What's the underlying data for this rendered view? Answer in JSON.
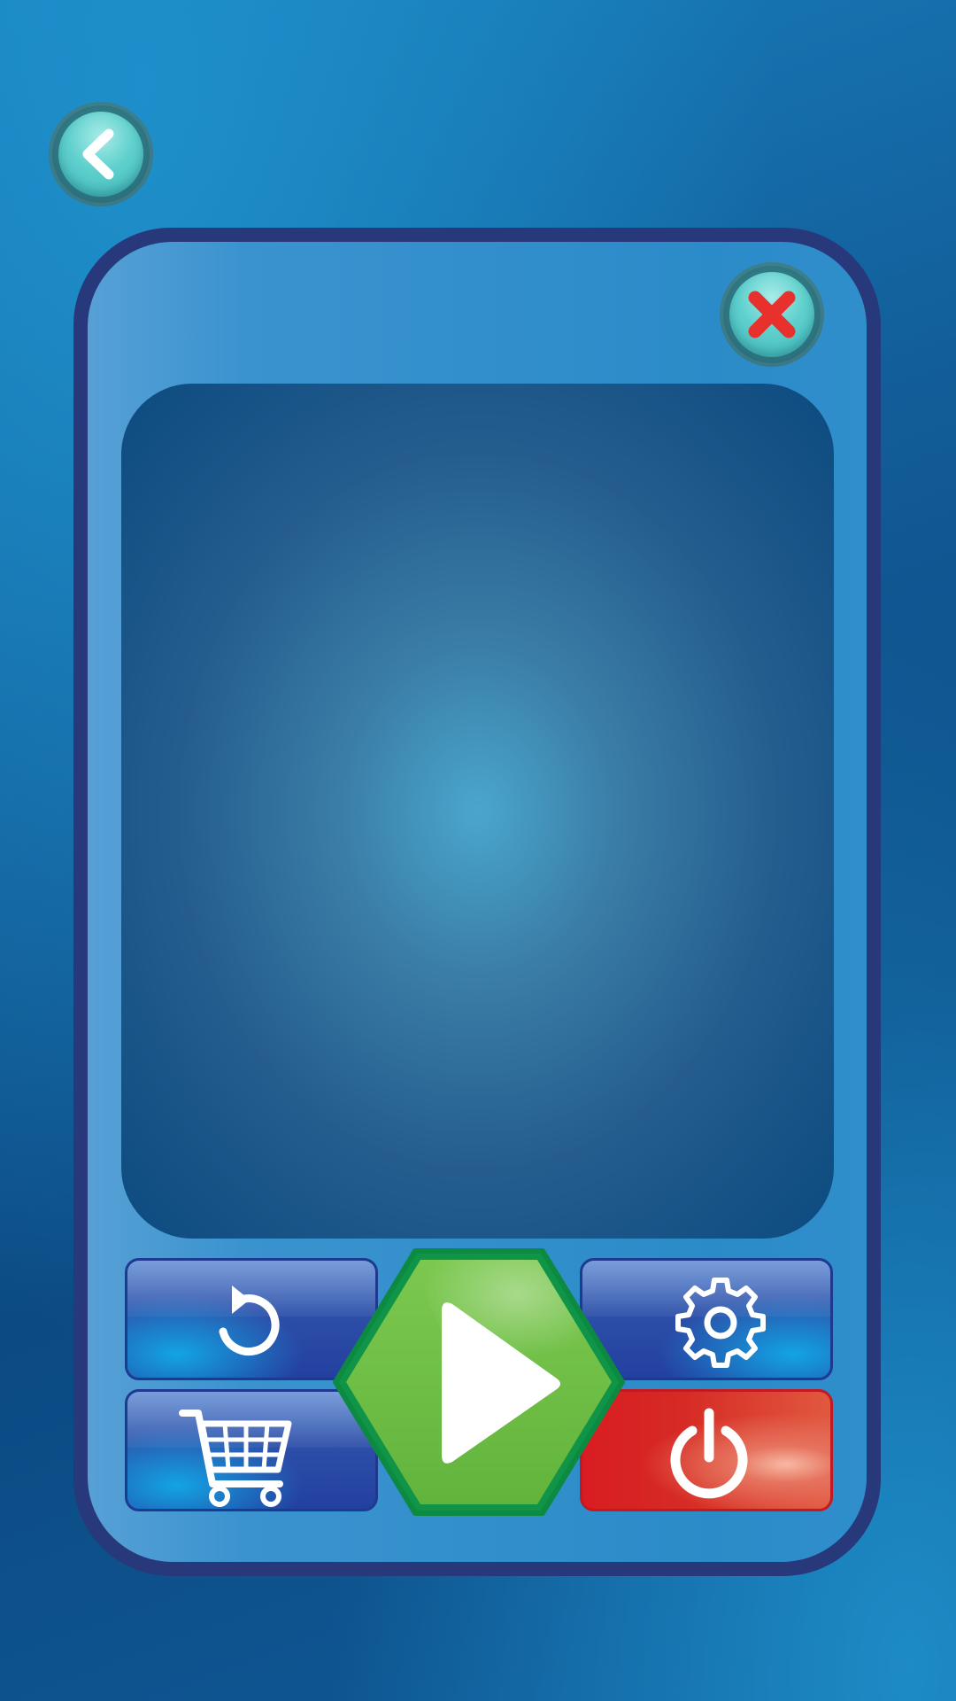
{
  "screen": "game-menu",
  "colors": {
    "background": "#125d99",
    "panel_border": "#27397a",
    "panel_fill": "#2b8bc8",
    "display": "#245c8e",
    "play_green": "#6cbd45",
    "power_red": "#d81d22",
    "accent_teal": "#5fd0cd",
    "close_x": "#e8302c"
  },
  "icons": {
    "back": "chevron-left-icon",
    "close": "close-x-icon",
    "undo": "undo-arrow-icon",
    "settings": "gear-icon",
    "cart": "shopping-cart-icon",
    "power": "power-icon",
    "play": "play-triangle-icon"
  },
  "display": {
    "content": ""
  }
}
